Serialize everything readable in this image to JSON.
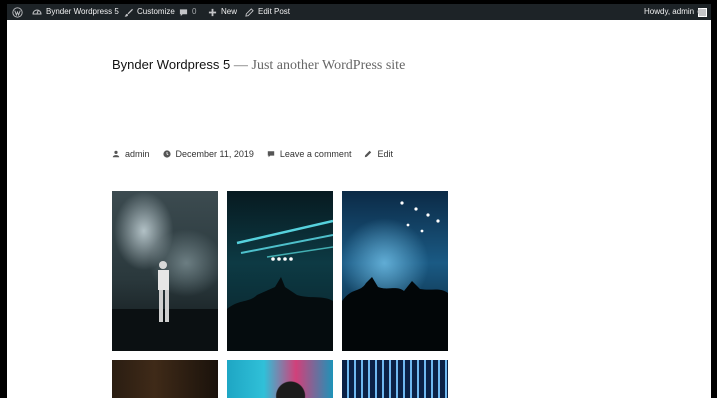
{
  "admin_bar": {
    "wp_logo_icon": "wordpress-logo-icon",
    "site_name": "Bynder Wordpress 5",
    "customize_label": "Customize",
    "comments_count": "0",
    "new_label": "New",
    "edit_post_label": "Edit Post",
    "howdy_label": "Howdy, admin",
    "search_icon": "search-icon"
  },
  "header": {
    "site_title": "Bynder Wordpress 5",
    "separator": "—",
    "description": "Just another WordPress site"
  },
  "post_meta": {
    "author": "admin",
    "date": "December 11, 2019",
    "comment_link": "Leave a comment",
    "edit_link": "Edit"
  },
  "gallery": {
    "images": [
      "concert-singer-smoke-photo",
      "concert-crowd-raised-hand-photo",
      "concert-stage-lights-crowd-photo",
      "dim-club-interior-photo",
      "colorful-portrait-photo",
      "neon-light-tunnel-photo"
    ]
  }
}
